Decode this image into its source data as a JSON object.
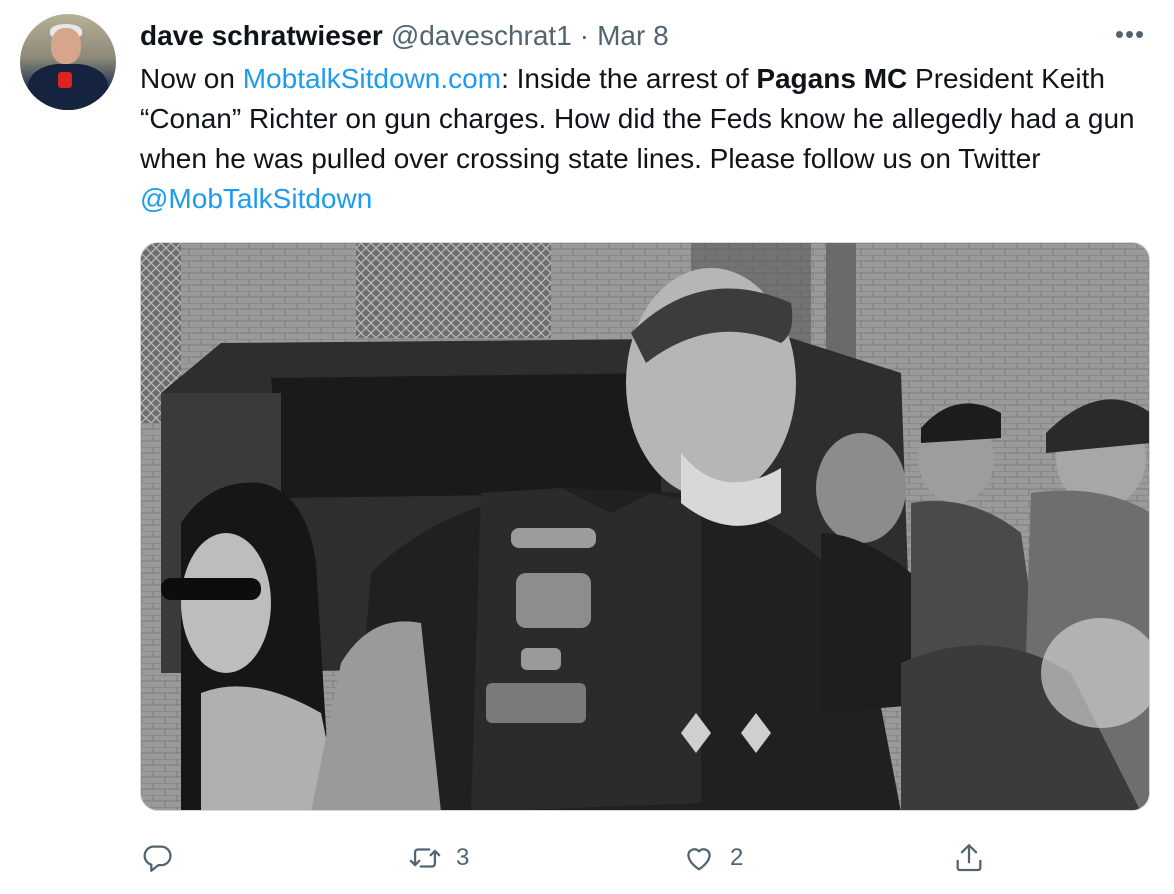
{
  "tweet": {
    "author": {
      "display_name": "dave schratwieser",
      "handle": "@daveschrat1",
      "separator": "·",
      "date": "Mar 8",
      "avatar_icon": "avatar"
    },
    "more_icon": "more-horizontal-icon",
    "more_label": "•••",
    "text": {
      "segment_1": "Now on ",
      "link_1": "MobtalkSitdown.com",
      "segment_2": ": Inside the arrest of ",
      "bold_1": "Pagans MC",
      "segment_3": " President Keith “Conan” Richter on gun charges. How did the Feds know he allegedly had a gun when he was pulled over crossing state lines. Please follow us on Twitter ",
      "mention_1": "@MobTalkSitdown"
    },
    "media": {
      "kind": "photo",
      "tone": "black-and-white"
    },
    "actions": {
      "reply_icon": "reply-icon",
      "retweet_icon": "retweet-icon",
      "retweet_count": "3",
      "like_icon": "like-icon",
      "like_count": "2",
      "share_icon": "share-icon"
    },
    "colors": {
      "link": "#1d9bf0",
      "secondary_text": "#536471",
      "primary_text": "#0f1419",
      "border": "#cfd9de"
    }
  }
}
